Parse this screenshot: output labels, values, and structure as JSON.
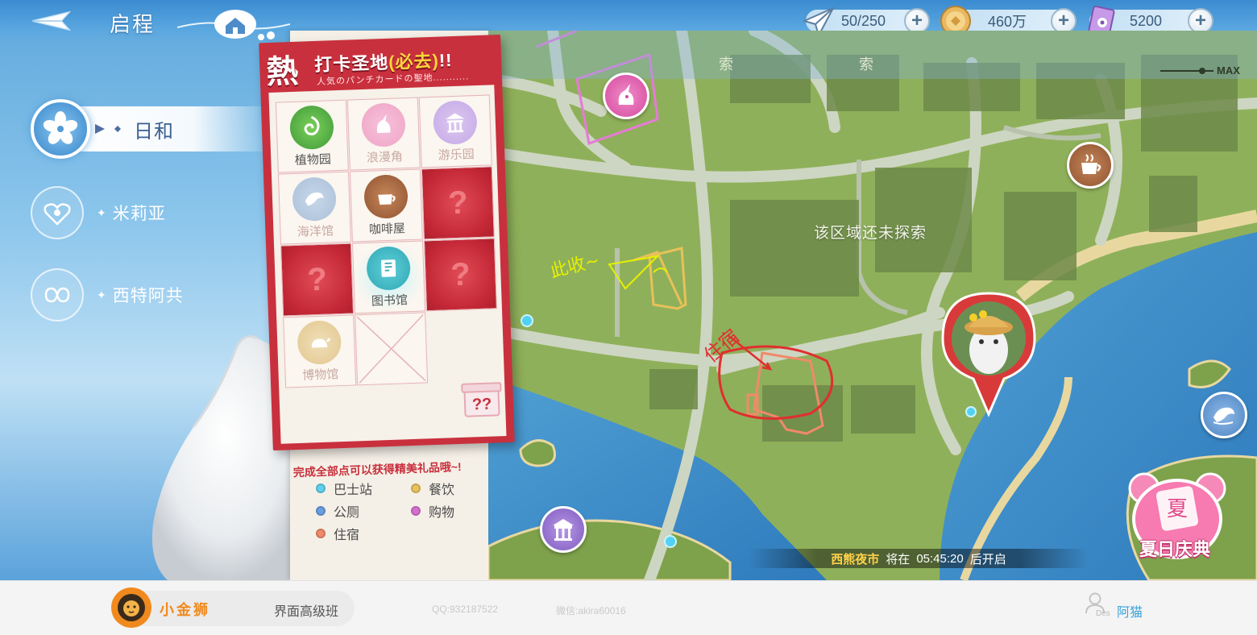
{
  "header": {
    "title": "启程",
    "back_icon": "paper-plane-back-icon"
  },
  "resources": [
    {
      "name": "stamina",
      "icon": "paper-plane-icon",
      "value": "50/250"
    },
    {
      "name": "coins",
      "icon": "gold-coin-icon",
      "value": "460万"
    },
    {
      "name": "tickets",
      "icon": "flower-ticket-icon",
      "value": "5200"
    }
  ],
  "characters": [
    {
      "label": "日和",
      "active": true
    },
    {
      "label": "米莉亚",
      "active": false
    },
    {
      "label": "西特阿共",
      "active": false
    }
  ],
  "checkin_card": {
    "hot": "熱",
    "title_prefix": "打卡圣地",
    "title_highlight": "(必去)",
    "title_suffix": "!!",
    "subtitle": "人気のパンチカードの聖地...........",
    "cells": [
      {
        "label": "植物园",
        "icon": "botanical-garden-icon",
        "state": "done"
      },
      {
        "label": "浪漫角",
        "icon": "unicorn-icon",
        "state": "faded"
      },
      {
        "label": "游乐园",
        "icon": "amusement-park-icon",
        "state": "faded"
      },
      {
        "label": "海洋馆",
        "icon": "dolphin-icon",
        "state": "faded"
      },
      {
        "label": "咖啡屋",
        "icon": "coffee-icon",
        "state": "normal"
      },
      {
        "label": "?",
        "icon": "locked-mystery-icon",
        "state": "locked"
      },
      {
        "label": "?",
        "icon": "locked-mystery-icon",
        "state": "locked"
      },
      {
        "label": "图书馆",
        "icon": "library-icon",
        "state": "done"
      },
      {
        "label": "?",
        "icon": "locked-mystery-icon",
        "state": "locked"
      },
      {
        "label": "博物馆",
        "icon": "museum-icon",
        "state": "faded"
      },
      {
        "label": "",
        "icon": "empty-slot-icon",
        "state": "empty"
      }
    ],
    "footer": "完成全部点可以获得精美礼品哦~!",
    "gift_text": "??"
  },
  "legend": [
    {
      "label": "巴士站",
      "color": "#5fd0ec"
    },
    {
      "label": "餐饮",
      "color": "#e8c15a"
    },
    {
      "label": "公厕",
      "color": "#6a9ee0"
    },
    {
      "label": "购物",
      "color": "#d56fd0"
    },
    {
      "label": "住宿",
      "color": "#ef8a6a"
    }
  ],
  "map": {
    "unexplored_text": "该区域还未探索",
    "faded_label_1": "索",
    "faded_label_2": "索",
    "zoom_label": "MAX",
    "handwriting_1": "此收~",
    "handwriting_2": "住宿",
    "market_name": "西熊夜市",
    "market_prefix": "将在",
    "market_time": "05:45:20",
    "market_suffix": "后开启"
  },
  "event_button": {
    "label": "夏日庆典",
    "badge": "夏"
  },
  "footer": {
    "brand_name": "小金狮",
    "course": "界面高级班",
    "qq": "QQ:932187522",
    "wechat": "微信:akira60016",
    "designer_tag": "Des",
    "designer_name": "阿猫"
  }
}
